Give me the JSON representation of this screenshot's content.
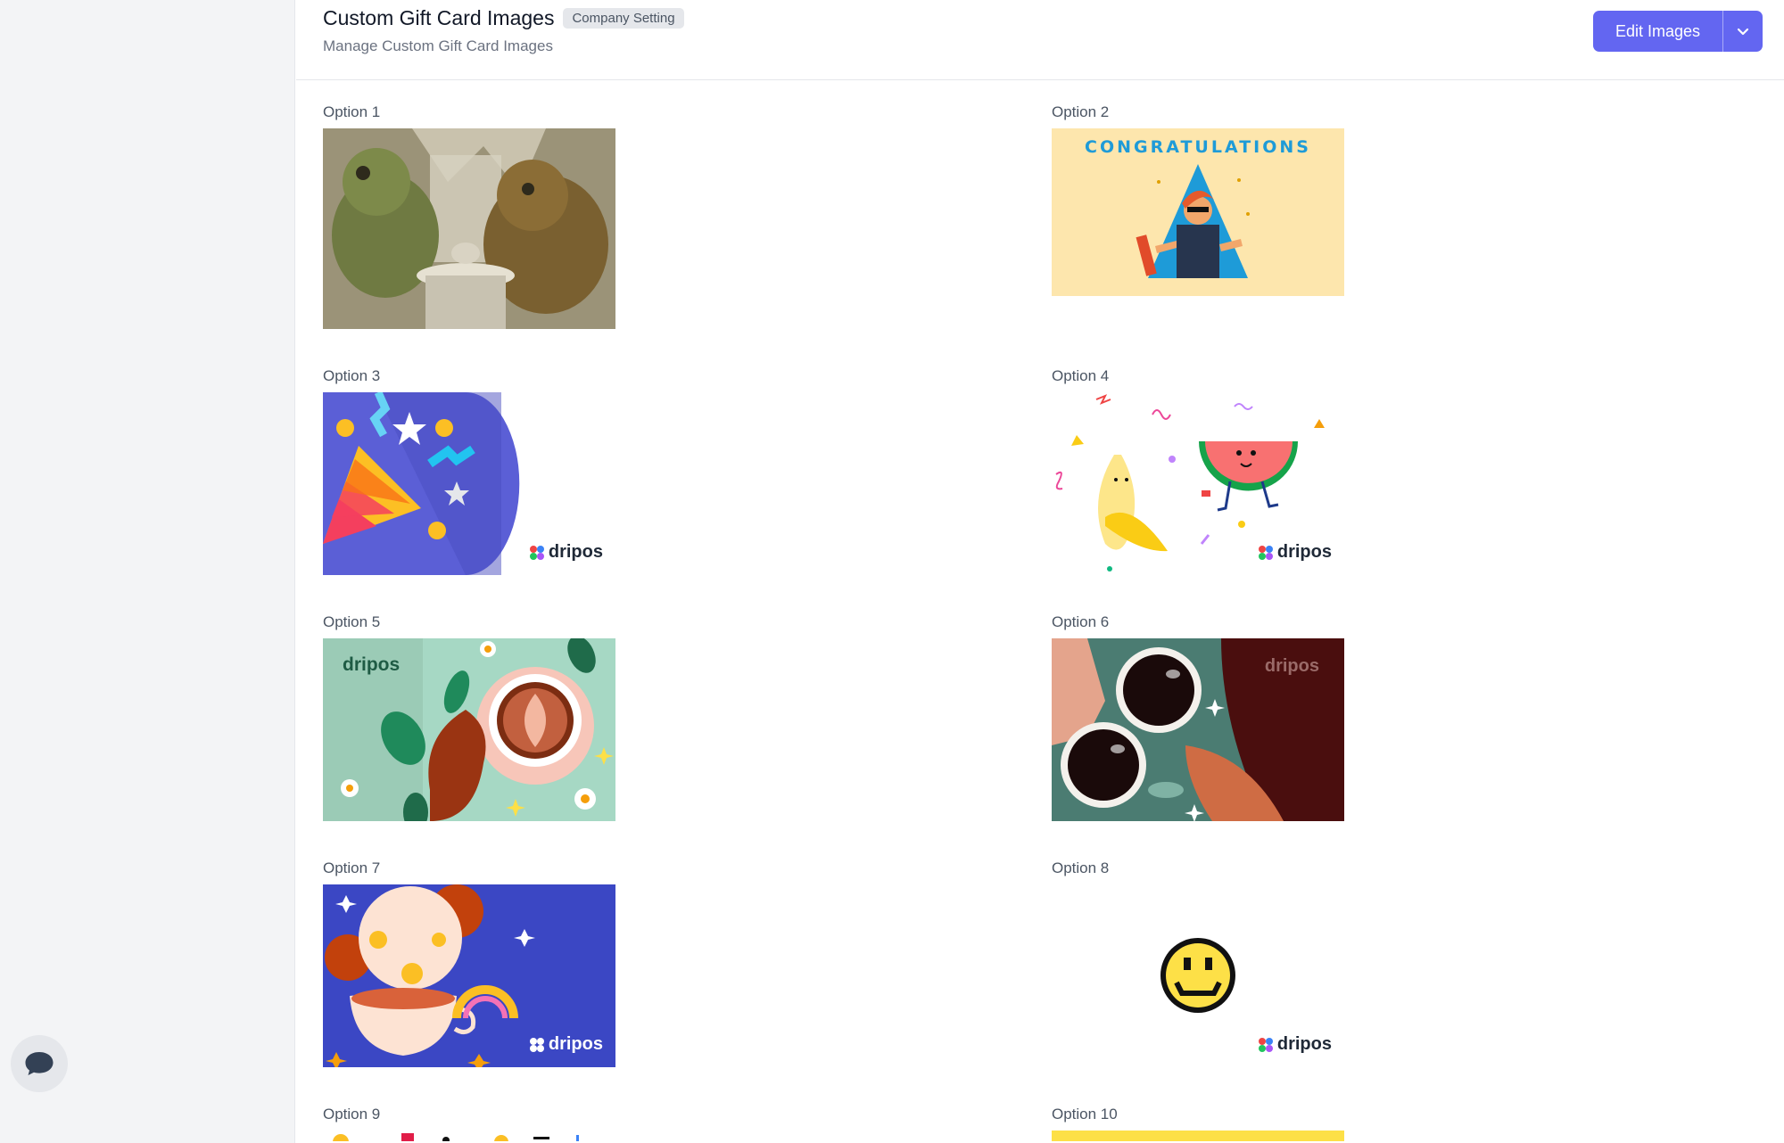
{
  "page": {
    "title": "Custom Gift Card Images",
    "badge": "Company Setting",
    "subtitle": "Manage Custom Gift Card Images"
  },
  "actions": {
    "edit_label": "Edit Images",
    "caret_icon": "chevron-down-icon"
  },
  "options": [
    {
      "label": "Option 1",
      "image": "frog-and-toad-tea-illustration"
    },
    {
      "label": "Option 2",
      "image": "congratulations-graduate-illustration",
      "text": "CONGRATULATIONS"
    },
    {
      "label": "Option 3",
      "image": "party-popper-illustration",
      "brand": "dripos"
    },
    {
      "label": "Option 4",
      "image": "banana-watermelon-confetti-illustration",
      "brand": "dripos"
    },
    {
      "label": "Option 5",
      "image": "latte-art-cup-illustration",
      "brand": "dripos"
    },
    {
      "label": "Option 6",
      "image": "coffee-cups-toast-illustration",
      "brand": "dripos"
    },
    {
      "label": "Option 7",
      "image": "teapot-cookies-illustration",
      "brand": "dripos"
    },
    {
      "label": "Option 8",
      "image": "pixel-smiley-face",
      "brand": "dripos"
    },
    {
      "label": "Option 9",
      "image": "partially-visible"
    },
    {
      "label": "Option 10",
      "image": "partially-visible-yellow"
    }
  ],
  "colors": {
    "accent": "#6366f1",
    "sidebar_bg": "#f3f4f6",
    "badge_bg": "#e5e7eb"
  }
}
